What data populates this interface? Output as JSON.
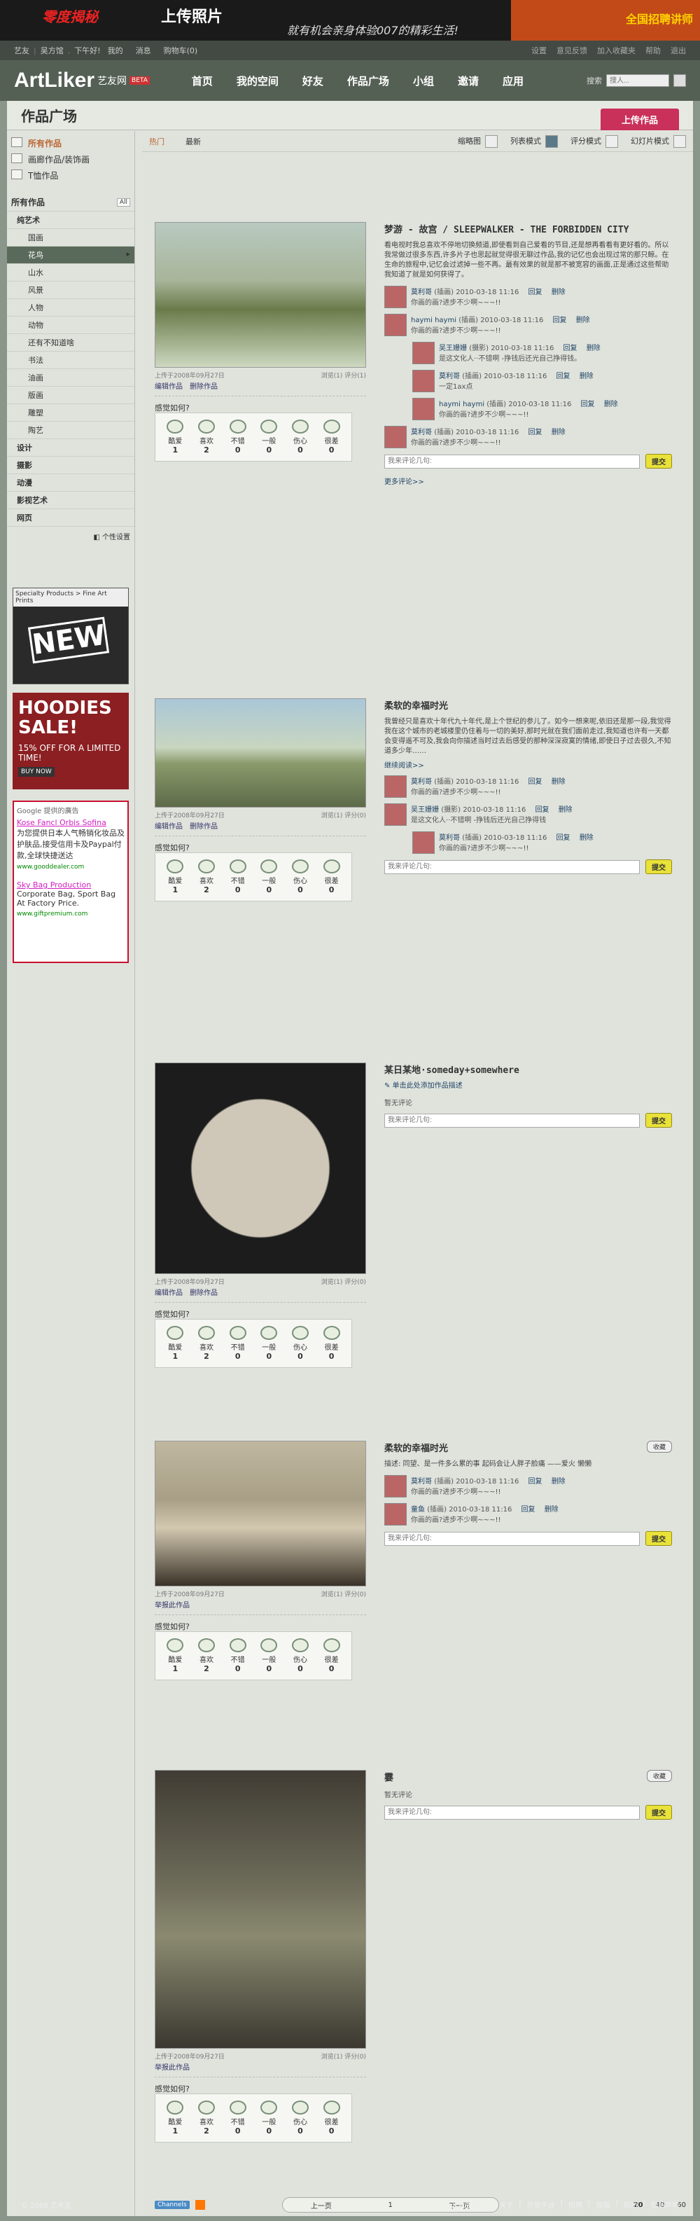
{
  "banner": {
    "left": "零度揭秘",
    "mid": "上传照片",
    "sub": "就有机会亲身体验007的精彩生活!",
    "right": "全国招聘讲师"
  },
  "topbar": {
    "brand": "艺友",
    "user": "吴方馆",
    "greet": "下午好!",
    "mine": "我的",
    "msg": "消息",
    "cart": "购物车",
    "cart_count": "(0)",
    "links": [
      "设置",
      "意见反馈",
      "加入收藏夹",
      "帮助",
      "退出"
    ]
  },
  "nav": {
    "logo": "ArtLiker",
    "logo_cn": "艺友网",
    "beta": "BETA",
    "items": [
      "首页",
      "我的空间",
      "好友",
      "作品广场",
      "小组",
      "邀请",
      "应用"
    ],
    "search_label": "搜索",
    "search_placeholder": "搜人..."
  },
  "page": {
    "title": "作品广场",
    "upload": "上传作品"
  },
  "sidebar": {
    "top": [
      "所有作品",
      "画廊作品/装饰画",
      "T恤作品"
    ],
    "cat_head": "所有作品",
    "all_btn": "All",
    "cats": [
      {
        "label": "纯艺术",
        "lvl": "l1",
        "sel": false
      },
      {
        "label": "国画",
        "lvl": "l2",
        "sel": false
      },
      {
        "label": "花鸟",
        "lvl": "l2",
        "sel": true
      },
      {
        "label": "山水",
        "lvl": "l2",
        "sel": false
      },
      {
        "label": "风景",
        "lvl": "l2",
        "sel": false
      },
      {
        "label": "人物",
        "lvl": "l2",
        "sel": false
      },
      {
        "label": "动物",
        "lvl": "l2",
        "sel": false
      },
      {
        "label": "还有不知道啥",
        "lvl": "l2",
        "sel": false
      },
      {
        "label": "书法",
        "lvl": "l2",
        "sel": false
      },
      {
        "label": "油画",
        "lvl": "l2",
        "sel": false
      },
      {
        "label": "版画",
        "lvl": "l2",
        "sel": false
      },
      {
        "label": "雕塑",
        "lvl": "l2",
        "sel": false
      },
      {
        "label": "陶艺",
        "lvl": "l2",
        "sel": false
      },
      {
        "label": "设计",
        "lvl": "l1",
        "sel": false
      },
      {
        "label": "摄影",
        "lvl": "l1",
        "sel": false
      },
      {
        "label": "动漫",
        "lvl": "l1",
        "sel": false
      },
      {
        "label": "影视艺术",
        "lvl": "l1",
        "sel": false
      },
      {
        "label": "网页",
        "lvl": "l1",
        "sel": false
      }
    ],
    "customize": "个性设置",
    "ad1_title": "Specialty Products > Fine Art Prints",
    "ad1_new": "NEW",
    "ad2_h": "HOODIES SALE!",
    "ad2_p": "15% OFF FOR A LIMITED TIME!",
    "ad2_b": "BUY NOW",
    "ad3_g": "Google 提供的廣告",
    "ad3_l1": "Kose Fancl Orbis Sofina",
    "ad3_t1": "为您提供日本人气畅销化妆品及护肤品,接受信用卡及Paypal付款,全球快捷送达",
    "ad3_u1": "www.gooddealer.com",
    "ad3_l2": "Sky Bag Production",
    "ad3_t2": "Corporate Bag, Sport Bag At Factory Price.",
    "ad3_u2": "www.giftpremium.com"
  },
  "toolbar": {
    "hot": "热门",
    "latest": "最新",
    "thumb": "缩略图",
    "list": "列表模式",
    "score": "评分模式",
    "slide": "幻灯片模式"
  },
  "feelings": {
    "title": "感觉如何?",
    "labels": [
      "酷爱",
      "喜欢",
      "不错",
      "一般",
      "伤心",
      "很差"
    ],
    "counts": [
      "1",
      "2",
      "0",
      "0",
      "0",
      "0"
    ]
  },
  "items": [
    {
      "title": "梦游 - 故宫 / SLEEPWALKER - THE FORBIDDEN CITY",
      "desc": "看电视时我总喜欢不停地切换频道,即使看到自己爱看的节目,还是想再看看有更好看的。所以我常做过很多东西,许多片子也思起就觉得很无聊过作品,我的记忆也会出现过常的那只鲸。在生命的旅程中,记忆会过滤掉一些不再。最有效果的就是那不被宽容的画面,正是通过这些帮助我知道了就是如何获得了。",
      "date": "上传于2008年09月27日",
      "stats": "浏览(1)  评分(1)",
      "ops": [
        "编辑作品",
        "删除作品"
      ],
      "comments": [
        {
          "name": "莫利哥",
          "role": "(插画)",
          "time": "2010-03-18 11:16",
          "text": "你画的画?进步不少啊~~~!!",
          "reply": false
        },
        {
          "name": "haymi haymi",
          "role": "(插画)",
          "time": "2010-03-18 11:16",
          "text": "你画的画?进步不少啊~~~!!",
          "reply": false
        },
        {
          "name": "吴王姗姗",
          "role": "(摄影)",
          "time": "2010-03-18 11:16",
          "text": "是这文化人··不错啊 -挣钱后还光自己挣得钱。",
          "reply": true
        },
        {
          "name": "莫利哥",
          "role": "(插画)",
          "time": "2010-03-18 11:16",
          "text": "一定1ax点",
          "reply": true
        },
        {
          "name": "haymi haymi",
          "role": "(插画)",
          "time": "2010-03-18 11:16",
          "text": "你画的画?进步不少啊~~~!!",
          "reply": true
        },
        {
          "name": "莫利哥",
          "role": "(插画)",
          "time": "2010-03-18 11:16",
          "text": "你画的画?进步不少啊~~~!!",
          "reply": false
        }
      ],
      "placeholder": "我来评论几句:",
      "submit": "提交",
      "more": "更多评论>>"
    },
    {
      "title": "柔软的幸福时光",
      "desc": "我曾经只是喜欢十年代九十年代,是上个世纪的参儿了。如今一想来呢,依旧还是那一段,我觉得我在这个城市的老城楼里仍住着与一切的美好,那时光就在我们面前走过,我知道也许有一天都会变得遥不可及,我会向你描述当时过去后感受的那种深深寂寞的情绪,即使日子过去很久,不知道多少年……",
      "date": "上传于2008年09月27日",
      "stats": "浏览(1)  评分(0)",
      "ops": [
        "编辑作品",
        "删除作品"
      ],
      "more_read": "继续阅读>>",
      "comments": [
        {
          "name": "莫利哥",
          "role": "(插画)",
          "time": "2010-03-18 11:16",
          "text": "你画的画?进步不少啊~~~!!",
          "reply": false
        },
        {
          "name": "吴王姗姗",
          "role": "(摄影)",
          "time": "2010-03-18 11:16",
          "text": "是这文化人··不错啊 -挣钱后还光自己挣得钱",
          "reply": false
        },
        {
          "name": "莫利哥",
          "role": "(插画)",
          "time": "2010-03-18 11:16",
          "text": "你画的画?进步不少啊~~~!!",
          "reply": true
        }
      ],
      "placeholder": "我来评论几句:",
      "submit": "提交"
    },
    {
      "title": "某日某地·someday+somewhere",
      "add_desc": "单击此处添加作品描述",
      "date": "上传于2008年09月27日",
      "stats": "浏览(1)  评分(0)",
      "ops": [
        "编辑作品",
        "删除作品"
      ],
      "nocom": "暂无评论",
      "placeholder": "我来评论几句:",
      "submit": "提交"
    },
    {
      "title": "柔软的幸福时光",
      "desc": "描述: 同望、是一件多么累的事  起码会让人胖子脸痛 ——爱火 懒懒",
      "date": "上传于2008年09月27日",
      "stats": "浏览(1)  评分(0)",
      "ops": [
        "举报此作品"
      ],
      "fav": "收藏",
      "comments": [
        {
          "name": "莫利哥",
          "role": "(插画)",
          "time": "2010-03-18 11:16",
          "text": "你画的画?进步不少啊~~~!!",
          "reply": false
        },
        {
          "name": "童鱼",
          "role": "(插画)",
          "time": "2010-03-18 11:16",
          "text": "你画的画?进步不少啊~~~!!",
          "reply": false
        }
      ],
      "placeholder": "我来评论几句:",
      "submit": "提交"
    },
    {
      "title": "霎",
      "date": "上传于2008年09月27日",
      "stats": "浏览(1)  评分(0)",
      "ops": [
        "举报此作品"
      ],
      "fav": "收藏",
      "nocom": "暂无评论",
      "placeholder": "我来评论几句:",
      "submit": "提交"
    }
  ],
  "pager": {
    "rss": "Channels",
    "prev": "上一页",
    "page": "1",
    "next": "下一页",
    "per": [
      "20",
      "40",
      "60"
    ]
  },
  "footer": {
    "copy": "© 2008 艺术生",
    "links": [
      "艺术生日志",
      "关于",
      "开放平台",
      "招聘",
      "客服",
      "帮助",
      "隐私声明"
    ]
  }
}
